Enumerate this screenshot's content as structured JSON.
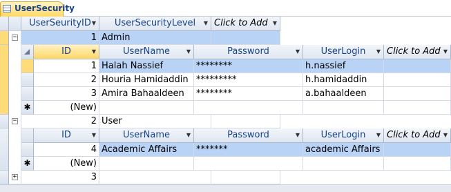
{
  "tab": {
    "title": "UserSecurity",
    "icon": "table-icon"
  },
  "parent_columns": [
    "UserSeurityID",
    "UserSecurityLevel",
    "Click to Add"
  ],
  "child_columns": [
    "ID",
    "UserName",
    "Password",
    "UserLogin",
    "Click to Add"
  ],
  "parent_rows": [
    {
      "id": "1",
      "level": "Admin",
      "expanded": true,
      "children": [
        {
          "id": "1",
          "username": "Halah Nassief",
          "password": "********",
          "login": "h.nassief"
        },
        {
          "id": "2",
          "username": "Houria Hamidaddin",
          "password": "*********",
          "login": "h.hamidaddin"
        },
        {
          "id": "3",
          "username": "Amira Bahaaldeen",
          "password": "********",
          "login": "a.bahaaldeen"
        }
      ],
      "new_label": "(New)"
    },
    {
      "id": "2",
      "level": "User",
      "expanded": true,
      "children": [
        {
          "id": "4",
          "username": "Academic Affairs",
          "password": "*******",
          "login": "academic Affairs"
        }
      ],
      "new_label": "(New)"
    },
    {
      "id": "3",
      "level": "",
      "expanded": false
    }
  ],
  "glyphs": {
    "expand": "+",
    "collapse": "−",
    "new_row": "✱",
    "dropdown": "▼"
  }
}
